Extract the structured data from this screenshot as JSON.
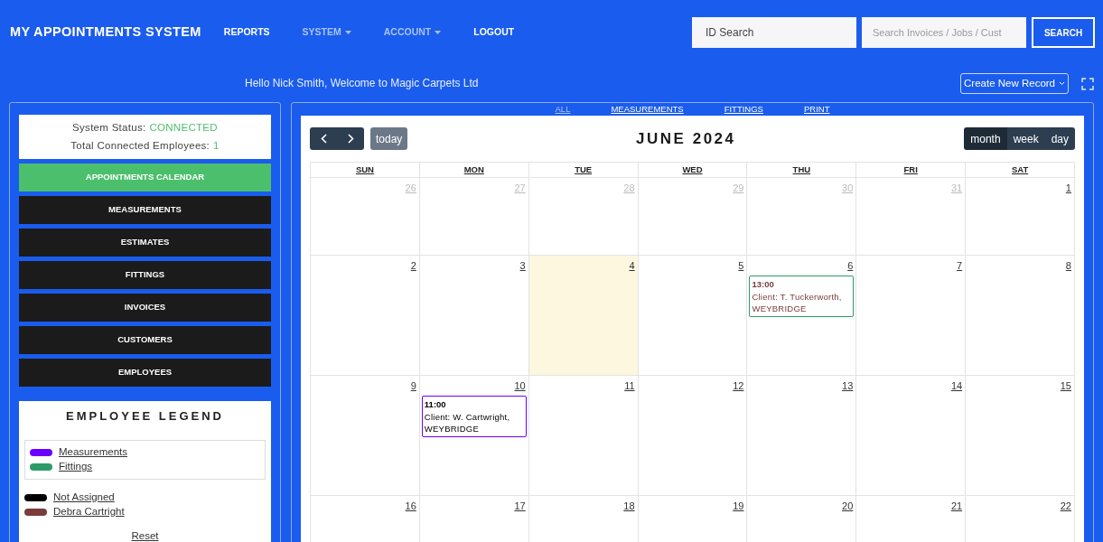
{
  "header": {
    "brand": "MY APPOINTMENTS SYSTEM",
    "nav": [
      {
        "label": "REPORTS",
        "kind": "link"
      },
      {
        "label": "SYSTEM",
        "kind": "dropdown"
      },
      {
        "label": "ACCOUNT",
        "kind": "dropdown"
      },
      {
        "label": "LOGOUT",
        "kind": "link"
      }
    ],
    "id_search": {
      "placeholder": "ID Search"
    },
    "search": {
      "placeholder": "Search Invoices / Jobs / Cust"
    },
    "search_button": "SEARCH"
  },
  "greeting": "Hello Nick Smith, Welcome to Magic Carpets Ltd",
  "create_button": "Create New Record",
  "sidebar": {
    "status_label": "System Status:",
    "status_value": "CONNECTED",
    "employees_label": "Total Connected Employees:",
    "employees_value": "1",
    "items": [
      {
        "label": "APPOINTMENTS CALENDAR",
        "selected": true
      },
      {
        "label": "MEASUREMENTS",
        "selected": false
      },
      {
        "label": "ESTIMATES",
        "selected": false
      },
      {
        "label": "FITTINGS",
        "selected": false
      },
      {
        "label": "INVOICES",
        "selected": false
      },
      {
        "label": "CUSTOMERS",
        "selected": false
      },
      {
        "label": "EMPLOYEES",
        "selected": false
      }
    ],
    "legend": {
      "title": "EMPLOYEE LEGEND",
      "types": [
        {
          "label": "Measurements",
          "color": "#6a00ff"
        },
        {
          "label": "Fittings",
          "color": "#2e9b68"
        }
      ],
      "employees": [
        {
          "label": "Not Assigned",
          "color": "#000000"
        },
        {
          "label": "Debra Cartright",
          "color": "#7a3b3b"
        }
      ],
      "reset": "Reset"
    }
  },
  "filters": [
    {
      "label": "ALL",
      "selected": true
    },
    {
      "label": "MEASUREMENTS",
      "selected": false
    },
    {
      "label": "FITTINGS",
      "selected": false
    },
    {
      "label": "PRINT",
      "selected": false
    }
  ],
  "calendar": {
    "title": "JUNE 2024",
    "today_button": "today",
    "views": [
      {
        "label": "month",
        "selected": true
      },
      {
        "label": "week",
        "selected": false
      },
      {
        "label": "day",
        "selected": false
      }
    ],
    "weekdays": [
      "SUN",
      "MON",
      "TUE",
      "WED",
      "THU",
      "FRI",
      "SAT"
    ],
    "weeks": [
      [
        {
          "day": "26",
          "other_month": true,
          "today": false
        },
        {
          "day": "27",
          "other_month": true,
          "today": false
        },
        {
          "day": "28",
          "other_month": true,
          "today": false
        },
        {
          "day": "29",
          "other_month": true,
          "today": false
        },
        {
          "day": "30",
          "other_month": true,
          "today": false
        },
        {
          "day": "31",
          "other_month": true,
          "today": false
        },
        {
          "day": "1",
          "other_month": false,
          "today": false
        }
      ],
      [
        {
          "day": "2",
          "other_month": false,
          "today": false
        },
        {
          "day": "3",
          "other_month": false,
          "today": false
        },
        {
          "day": "4",
          "other_month": false,
          "today": true
        },
        {
          "day": "5",
          "other_month": false,
          "today": false
        },
        {
          "day": "6",
          "other_month": false,
          "today": false,
          "events": [
            {
              "time": "13:00",
              "text": "Client: T. Tuckerworth, WEYBRIDGE",
              "kind": "fitting",
              "color": "#7a3b3b"
            }
          ]
        },
        {
          "day": "7",
          "other_month": false,
          "today": false
        },
        {
          "day": "8",
          "other_month": false,
          "today": false
        }
      ],
      [
        {
          "day": "9",
          "other_month": false,
          "today": false
        },
        {
          "day": "10",
          "other_month": false,
          "today": false,
          "events": [
            {
              "time": "11:00",
              "text": "Client: W. Cartwright, WEYBRIDGE",
              "kind": "measurement",
              "color": "#000000"
            }
          ]
        },
        {
          "day": "11",
          "other_month": false,
          "today": false
        },
        {
          "day": "12",
          "other_month": false,
          "today": false
        },
        {
          "day": "13",
          "other_month": false,
          "today": false
        },
        {
          "day": "14",
          "other_month": false,
          "today": false
        },
        {
          "day": "15",
          "other_month": false,
          "today": false
        }
      ],
      [
        {
          "day": "16",
          "other_month": false,
          "today": false
        },
        {
          "day": "17",
          "other_month": false,
          "today": false
        },
        {
          "day": "18",
          "other_month": false,
          "today": false
        },
        {
          "day": "19",
          "other_month": false,
          "today": false
        },
        {
          "day": "20",
          "other_month": false,
          "today": false
        },
        {
          "day": "21",
          "other_month": false,
          "today": false
        },
        {
          "day": "22",
          "other_month": false,
          "today": false
        }
      ]
    ]
  }
}
